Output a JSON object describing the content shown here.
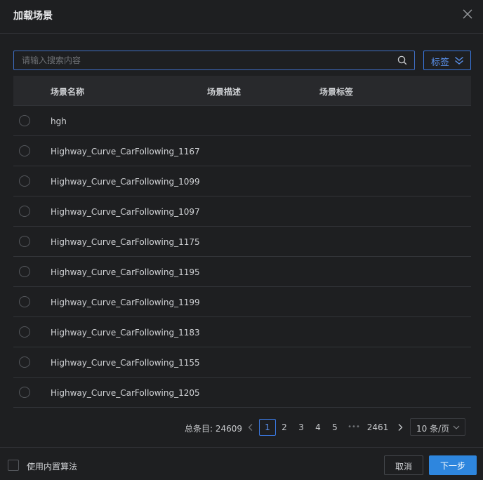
{
  "dialog": {
    "title": "加载场景"
  },
  "search": {
    "placeholder": "请输入搜索内容",
    "value": ""
  },
  "tag_filter": {
    "label": "标签"
  },
  "table": {
    "headers": [
      "场景名称",
      "场景描述",
      "场景标签"
    ],
    "rows": [
      {
        "name": "hgh",
        "description": "",
        "tags": ""
      },
      {
        "name": "Highway_Curve_CarFollowing_1167",
        "description": "",
        "tags": ""
      },
      {
        "name": "Highway_Curve_CarFollowing_1099",
        "description": "",
        "tags": ""
      },
      {
        "name": "Highway_Curve_CarFollowing_1097",
        "description": "",
        "tags": ""
      },
      {
        "name": "Highway_Curve_CarFollowing_1175",
        "description": "",
        "tags": ""
      },
      {
        "name": "Highway_Curve_CarFollowing_1195",
        "description": "",
        "tags": ""
      },
      {
        "name": "Highway_Curve_CarFollowing_1199",
        "description": "",
        "tags": ""
      },
      {
        "name": "Highway_Curve_CarFollowing_1183",
        "description": "",
        "tags": ""
      },
      {
        "name": "Highway_Curve_CarFollowing_1155",
        "description": "",
        "tags": ""
      },
      {
        "name": "Highway_Curve_CarFollowing_1205",
        "description": "",
        "tags": ""
      }
    ]
  },
  "pagination": {
    "total_label": "总条目: 24609",
    "pages": [
      "1",
      "2",
      "3",
      "4",
      "5"
    ],
    "ellipsis": "•••",
    "last_page": "2461",
    "current_page": "1",
    "page_size": "10 条/页"
  },
  "footer": {
    "builtin_algorithm_label": "使用内置算法",
    "cancel_label": "取消",
    "next_label": "下一步"
  },
  "colors": {
    "background": "#1e1f21",
    "accent": "#2e86de",
    "link": "#5b93f0"
  }
}
